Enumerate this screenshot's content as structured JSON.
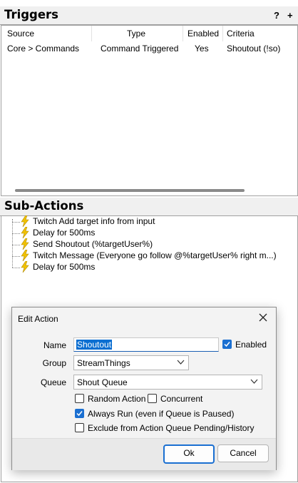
{
  "triggers": {
    "title": "Triggers",
    "help_label": "?",
    "add_label": "+",
    "columns": [
      "Source",
      "Type",
      "Enabled",
      "Criteria"
    ],
    "rows": [
      {
        "source": "Core > Commands",
        "type": "Command Triggered",
        "enabled": "Yes",
        "criteria": "Shoutout (!so)"
      }
    ]
  },
  "sub_actions": {
    "title": "Sub-Actions",
    "items": [
      {
        "label": "Twitch Add target info from input",
        "icon": "lightning-icon"
      },
      {
        "label": "Delay for 500ms",
        "icon": "lightning-icon"
      },
      {
        "label": "Send Shoutout (%targetUser%)",
        "icon": "lightning-icon"
      },
      {
        "label": "Twitch Message (Everyone go follow @%targetUser% right m...)",
        "icon": "lightning-icon"
      },
      {
        "label": "Delay for 500ms",
        "icon": "lightning-icon"
      }
    ]
  },
  "dialog": {
    "title": "Edit Action",
    "close_icon": "close-icon",
    "name_label": "Name",
    "name_value": "Shoutout",
    "enabled_label": "Enabled",
    "enabled_checked": true,
    "group_label": "Group",
    "group_value": "StreamThings",
    "queue_label": "Queue",
    "queue_value": "Shout Queue",
    "random_action_label": "Random Action",
    "random_action_checked": false,
    "concurrent_label": "Concurrent",
    "concurrent_checked": false,
    "always_run_label": "Always Run (even if Queue is Paused)",
    "always_run_checked": true,
    "exclude_label": "Exclude from Action Queue Pending/History",
    "exclude_checked": false,
    "ok_label": "Ok",
    "cancel_label": "Cancel"
  },
  "colors": {
    "accent": "#1a6fd1",
    "bolt": "#f2c200",
    "header_bg": "#f0f0f0"
  }
}
